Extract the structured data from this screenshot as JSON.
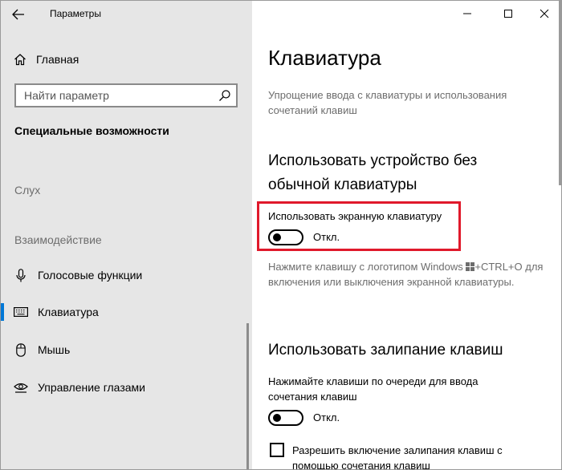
{
  "app": {
    "title": "Параметры"
  },
  "sidebar": {
    "home_label": "Главная",
    "search_placeholder": "Найти параметр",
    "section_title": "Специальные возможности",
    "groups": {
      "hearing": "Слух",
      "interaction": "Взаимодействие"
    },
    "items": [
      {
        "label": "Голосовые функции",
        "icon": "microphone-icon"
      },
      {
        "label": "Клавиатура",
        "icon": "keyboard-icon",
        "active": true
      },
      {
        "label": "Мышь",
        "icon": "mouse-icon"
      },
      {
        "label": "Управление глазами",
        "icon": "eye-control-icon"
      }
    ]
  },
  "main": {
    "title": "Клавиатура",
    "description": "Упрощение ввода с клавиатуры и использования сочетаний клавиш",
    "onscreen": {
      "heading": "Использовать устройство без обычной клавиатуры",
      "option_label": "Использовать экранную клавиатуру",
      "toggle_state": "Откл.",
      "note_before": "Нажмите клавишу с логотипом Windows ",
      "note_after": "+CTRL+O для включения или выключения экранной клавиатуры."
    },
    "sticky": {
      "heading": "Использовать залипание клавиш",
      "option_label": "Нажимайте клавиши по очереди для ввода сочетания клавиш",
      "toggle_state": "Откл.",
      "checkbox_label": "Разрешить включение залипания клавиш с помощью сочетания клавиш"
    }
  },
  "colors": {
    "accent": "#0078d7",
    "highlight": "#e0192b",
    "sidebar_bg": "#e6e6e6"
  }
}
